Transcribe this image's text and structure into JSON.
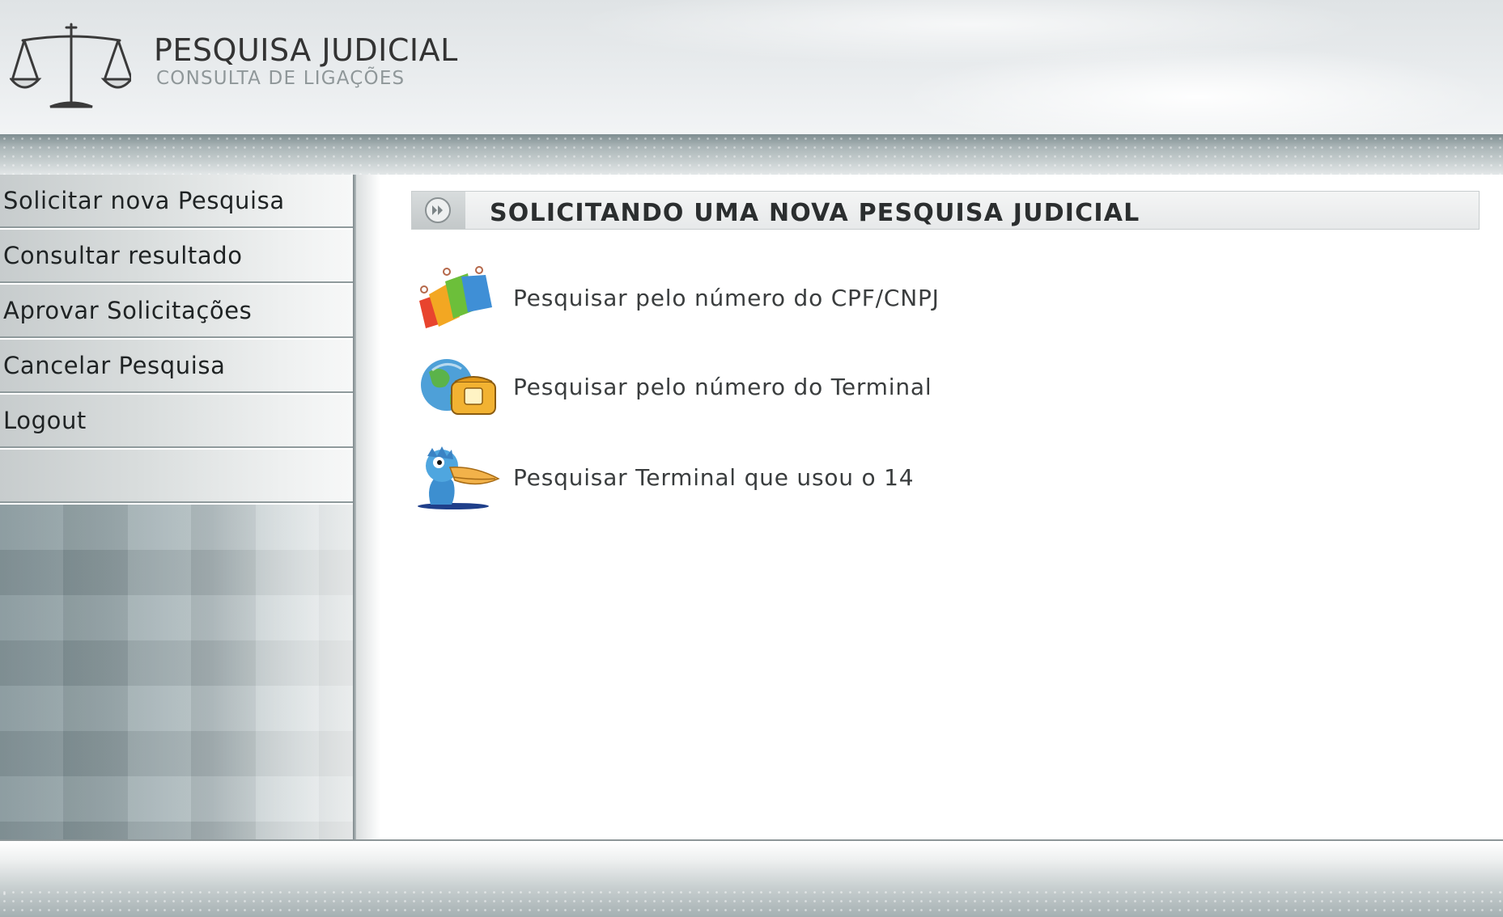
{
  "header": {
    "title": "PESQUISA JUDICIAL",
    "subtitle": "CONSULTA DE LIGAÇÕES",
    "logo_icon": "scales-of-justice-icon"
  },
  "sidebar": {
    "items": [
      {
        "label": "Solicitar nova Pesquisa"
      },
      {
        "label": "Consultar resultado"
      },
      {
        "label": "Aprovar Solicitações"
      },
      {
        "label": "Cancelar Pesquisa"
      },
      {
        "label": "Logout"
      }
    ]
  },
  "main": {
    "section_title": "SOLICITANDO UMA NOVA PESQUISA JUDICIAL",
    "section_icon": "forward-arrows-icon",
    "options": [
      {
        "label": "Pesquisar pelo número do CPF/CNPJ",
        "icon": "documents-icon"
      },
      {
        "label": "Pesquisar pelo número do Terminal",
        "icon": "globe-phone-icon"
      },
      {
        "label": "Pesquisar Terminal que usou o 14",
        "icon": "bird-mascot-icon"
      }
    ]
  },
  "colors": {
    "header_bg": "#e9ecee",
    "band": "#a9b4b6",
    "nav_bg": "#d9dddd",
    "sidebar_pattern": "#93a3a7",
    "text_dark": "#1f2324"
  }
}
